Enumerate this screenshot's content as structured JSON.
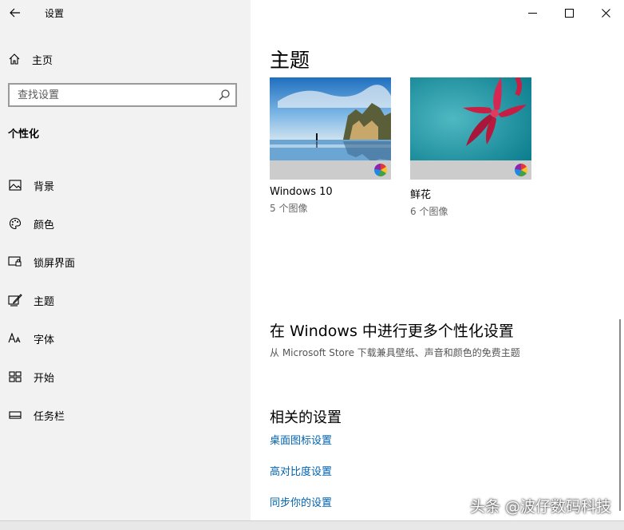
{
  "app": {
    "title": "设置"
  },
  "sidebar": {
    "home_label": "主页",
    "search_placeholder": "查找设置",
    "section_title": "个性化",
    "items": [
      {
        "label": "背景",
        "icon": "picture-icon"
      },
      {
        "label": "颜色",
        "icon": "palette-icon"
      },
      {
        "label": "锁屏界面",
        "icon": "lock-screen-icon"
      },
      {
        "label": "主题",
        "icon": "theme-brush-icon"
      },
      {
        "label": "字体",
        "icon": "font-icon"
      },
      {
        "label": "开始",
        "icon": "start-grid-icon"
      },
      {
        "label": "任务栏",
        "icon": "taskbar-icon"
      }
    ]
  },
  "main": {
    "title": "主题",
    "themes": [
      {
        "name": "Windows 10",
        "count": "5 个图像"
      },
      {
        "name": "鲜花",
        "count": "6 个图像"
      }
    ],
    "more": {
      "title": "在 Windows 中进行更多个性化设置",
      "desc": "从 Microsoft Store 下载兼具壁纸、声音和颜色的免费主题"
    },
    "related": {
      "title": "相关的设置",
      "links": [
        "桌面图标设置",
        "高对比度设置",
        "同步你的设置"
      ]
    }
  },
  "watermark": "头条 @波仔数码科技",
  "colors": {
    "accent": "#0063b1",
    "sidebar_bg": "#f2f2f2"
  }
}
